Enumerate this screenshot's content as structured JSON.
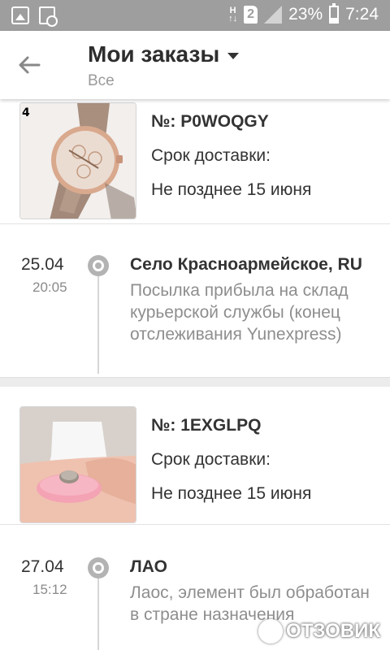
{
  "status_bar": {
    "battery": "23%",
    "time": "7:24",
    "network": "H",
    "sim": "2"
  },
  "header": {
    "title": "Мои заказы",
    "filter": "Все"
  },
  "orders": [
    {
      "thumb_label": "4",
      "number": "№: P0WOQGY",
      "delivery_label": "Срок доставки:",
      "delivery_value": "Не позднее 15 июня",
      "tracking": {
        "date": "25.04",
        "time": "20:05",
        "place": "Село Красноармейское, RU",
        "description": "Посылка прибыла на склад курьерской службы (конец отслеживания Yunexpress)"
      }
    },
    {
      "thumb_label": "",
      "number": "№: 1EXGLPQ",
      "delivery_label": "Срок доставки:",
      "delivery_value": "Не позднее 15 июня",
      "tracking": {
        "date": "27.04",
        "time": "15:12",
        "place": "ЛАО",
        "description": "Лаос, элемент был обработан в стране назначения"
      }
    }
  ],
  "watermark": "ОТЗОВИК"
}
